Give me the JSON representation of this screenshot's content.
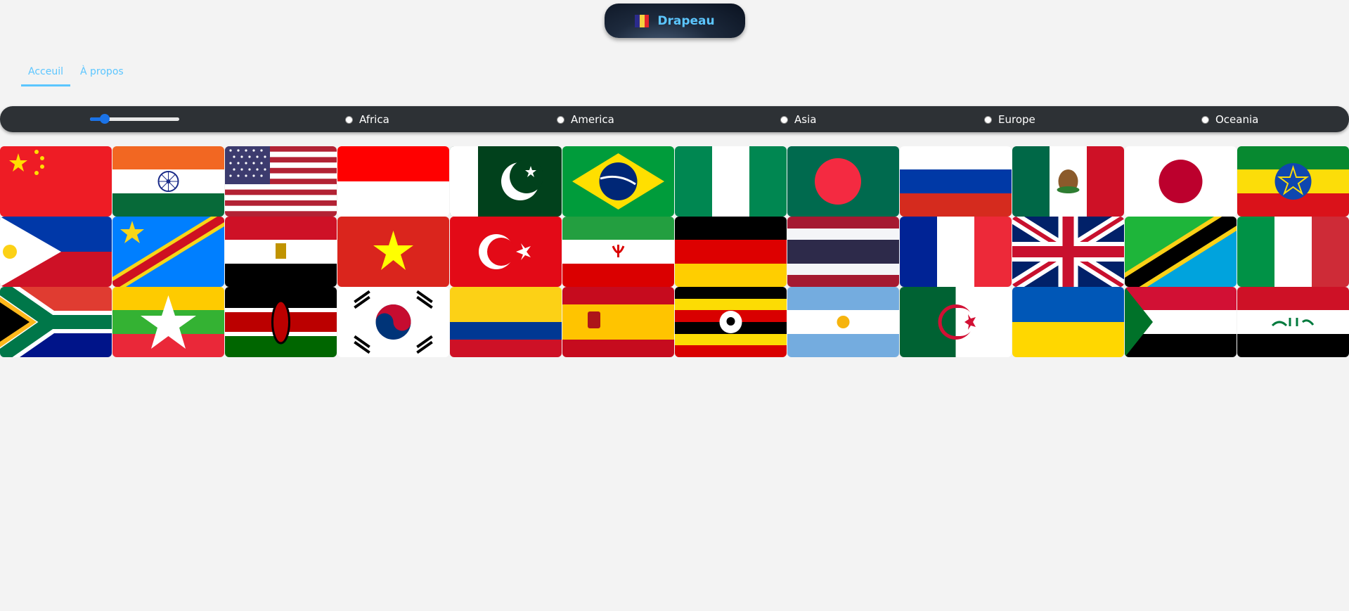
{
  "header": {
    "title": "Drapeau",
    "logo_icon": "flag-icon",
    "logo_colors": [
      "#2b2b8c",
      "#f4d03f",
      "#e2242c"
    ]
  },
  "nav": {
    "tabs": [
      {
        "label": "Acceuil",
        "active": true
      },
      {
        "label": "À propos",
        "active": false
      }
    ]
  },
  "filters": {
    "slider_value": 0.12,
    "regions": [
      "Africa",
      "America",
      "Asia",
      "Europe",
      "Oceania"
    ],
    "accent": "#5cc6ff"
  },
  "flags": [
    "China",
    "India",
    "United States",
    "Indonesia",
    "Pakistan",
    "Brazil",
    "Nigeria",
    "Bangladesh",
    "Russia",
    "Mexico",
    "Japan",
    "Ethiopia",
    "Philippines",
    "DR Congo",
    "Egypt",
    "Vietnam",
    "Turkey",
    "Iran",
    "Germany",
    "Thailand",
    "France",
    "United Kingdom",
    "Tanzania",
    "Italy",
    "South Africa",
    "Myanmar",
    "Kenya",
    "South Korea",
    "Colombia",
    "Spain",
    "Uganda",
    "Argentina",
    "Algeria",
    "Ukraine",
    "Sudan",
    "Iraq"
  ]
}
